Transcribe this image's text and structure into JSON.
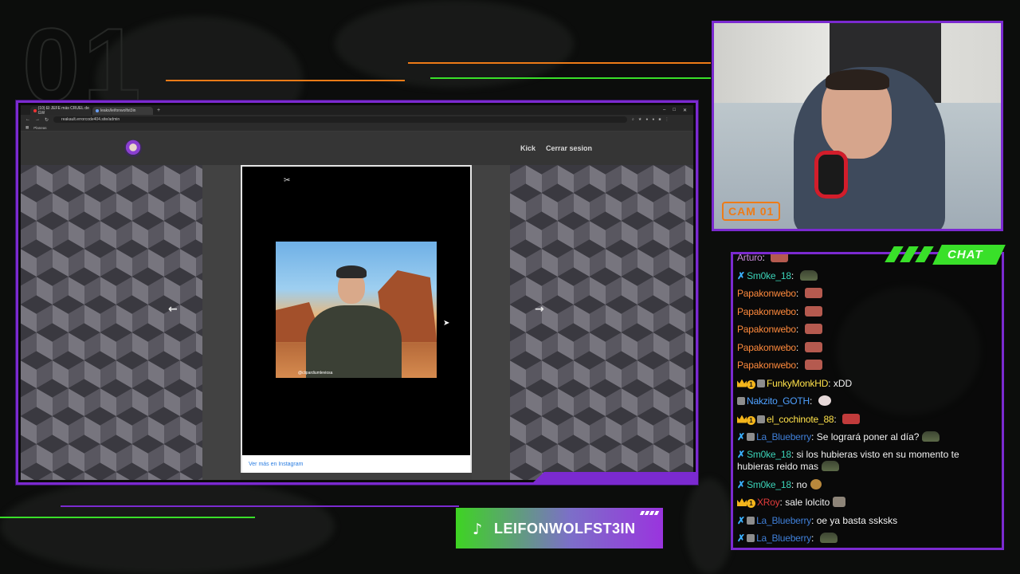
{
  "overlay": {
    "bg_number": "01",
    "cam_label": "CAM 01",
    "chat_title": "CHAT",
    "tiktok_handle": "LEIFONWOLFST3IN",
    "colors": {
      "accent_purple": "#7b2ad0",
      "accent_green": "#39e029",
      "accent_orange": "#ee7b17"
    }
  },
  "browser": {
    "tabs": [
      {
        "label": "(10) El JEFE más CRUEL de GW"
      },
      {
        "label": "leaks/leifonwolfst3in"
      }
    ],
    "url": "reakault.errorcode404.site/admin",
    "bookmark": "Planeas"
  },
  "site": {
    "nav": {
      "kick": "Kick",
      "logout": "Cerrar sesion"
    },
    "embed": {
      "credit": "@clipardiumleviosa",
      "footer_link": "Ver más en Instagram"
    },
    "prev_icon": "arrow-left-icon",
    "next_icon": "arrow-right-icon"
  },
  "chat": {
    "messages": [
      {
        "user": "Arturo",
        "text": "",
        "user_color": "#c98bdb",
        "badges": [],
        "emote": "face"
      },
      {
        "user": "Sm0ke_18",
        "text": "",
        "user_color": "#3bd3b8",
        "badges": [
          "sword"
        ],
        "emote": "tank"
      },
      {
        "user": "Papakonwebo",
        "text": "",
        "user_color": "#ff8a3c",
        "badges": [],
        "emote": "face"
      },
      {
        "user": "Papakonwebo",
        "text": "",
        "user_color": "#ff8a3c",
        "badges": [],
        "emote": "face"
      },
      {
        "user": "Papakonwebo",
        "text": "",
        "user_color": "#ff8a3c",
        "badges": [],
        "emote": "face"
      },
      {
        "user": "Papakonwebo",
        "text": "",
        "user_color": "#ff8a3c",
        "badges": [],
        "emote": "face"
      },
      {
        "user": "Papakonwebo",
        "text": "",
        "user_color": "#ff8a3c",
        "badges": [],
        "emote": "face"
      },
      {
        "user": "FunkyMonkHD",
        "text": "xDD",
        "user_color": "#ffe24a",
        "badges": [
          "crown",
          "one",
          "misc"
        ],
        "emote": ""
      },
      {
        "user": "Nakzito_GOTH",
        "text": "",
        "user_color": "#4ea0ff",
        "badges": [
          "misc"
        ],
        "emote": "cow"
      },
      {
        "user": "el_cochinote_88",
        "text": "",
        "user_color": "#ffe24a",
        "badges": [
          "crown",
          "one",
          "misc"
        ],
        "emote": "lips"
      },
      {
        "user": "La_Blueberry",
        "text": "Se logrará poner al día?",
        "user_color": "#3f7fd8",
        "badges": [
          "sword",
          "misc"
        ],
        "emote": "tank"
      },
      {
        "user": "Sm0ke_18",
        "text": "si los hubieras visto en su momento te hubieras reido mas",
        "user_color": "#3bd3b8",
        "badges": [
          "sword"
        ],
        "emote": "tank",
        "wrap": true
      },
      {
        "user": "Sm0ke_18",
        "text": "no",
        "user_color": "#3bd3b8",
        "badges": [
          "sword"
        ],
        "emote": "cat"
      },
      {
        "user": "XRoy",
        "text": "sale lolcito",
        "user_color": "#e23b3b",
        "badges": [
          "crown",
          "one"
        ],
        "emote": "gray"
      },
      {
        "user": "La_Blueberry",
        "text": "oe ya basta ssksks",
        "user_color": "#3f7fd8",
        "badges": [
          "sword",
          "misc"
        ],
        "emote": ""
      },
      {
        "user": "La_Blueberry",
        "text": "",
        "user_color": "#3f7fd8",
        "badges": [
          "sword",
          "misc"
        ],
        "emote": "tank"
      }
    ]
  }
}
